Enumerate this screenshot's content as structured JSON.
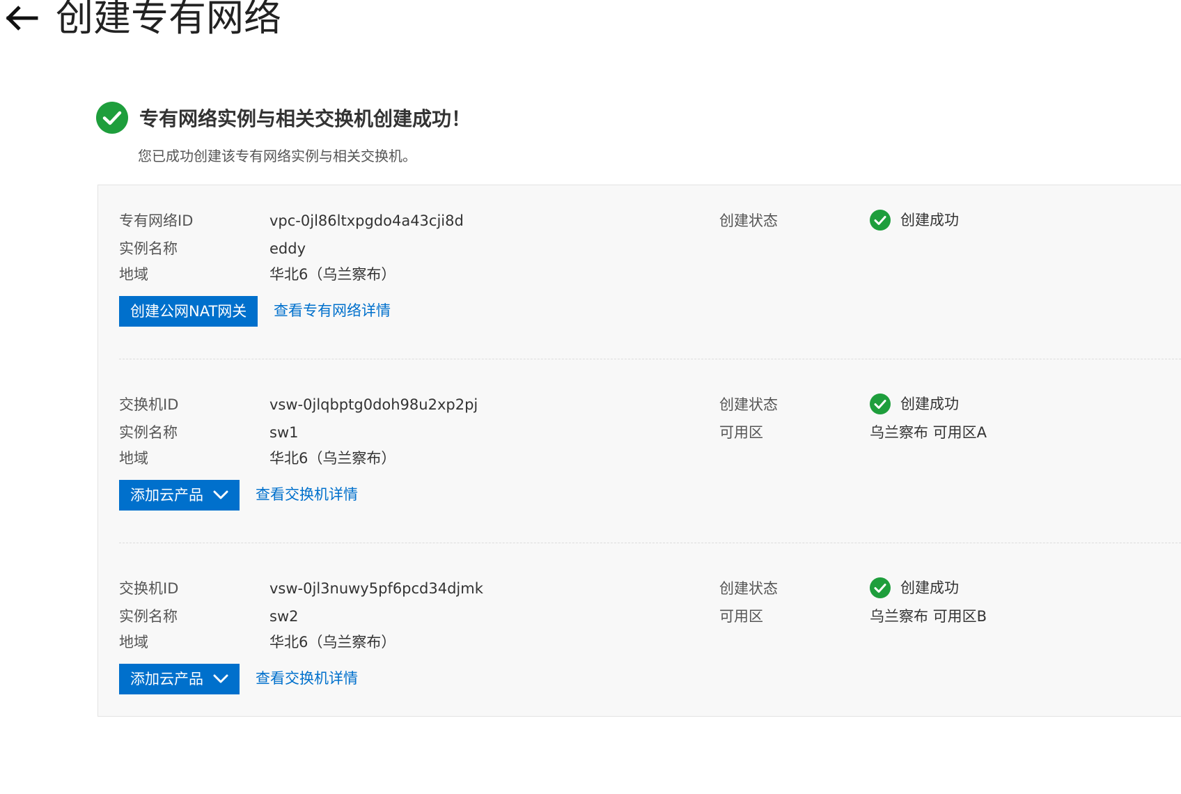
{
  "header": {
    "title": "创建专有网络"
  },
  "success": {
    "title": "专有网络实例与相关交换机创建成功！",
    "description": "您已成功创建该专有网络实例与相关交换机。"
  },
  "colors": {
    "primary": "#0070cc",
    "success": "#1e9e3c"
  },
  "vpc": {
    "id_label": "专有网络ID",
    "id": "vpc-0jl86ltxpgdo4a43cji8d",
    "name_label": "实例名称",
    "name": "eddy",
    "region_label": "地域",
    "region": "华北6（乌兰察布）",
    "status_label": "创建状态",
    "status": "创建成功",
    "primary_button": "创建公网NAT网关",
    "detail_link": "查看专有网络详情"
  },
  "vswitches": [
    {
      "id_label": "交换机ID",
      "id": "vsw-0jlqbptg0doh98u2xp2pj",
      "name_label": "实例名称",
      "name": "sw1",
      "region_label": "地域",
      "region": "华北6（乌兰察布）",
      "status_label": "创建状态",
      "status": "创建成功",
      "zone_label": "可用区",
      "zone": "乌兰察布 可用区A",
      "add_button": "添加云产品",
      "detail_link": "查看交换机详情"
    },
    {
      "id_label": "交换机ID",
      "id": "vsw-0jl3nuwy5pf6pcd34djmk",
      "name_label": "实例名称",
      "name": "sw2",
      "region_label": "地域",
      "region": "华北6（乌兰察布）",
      "status_label": "创建状态",
      "status": "创建成功",
      "zone_label": "可用区",
      "zone": "乌兰察布 可用区B",
      "add_button": "添加云产品",
      "detail_link": "查看交换机详情"
    }
  ]
}
